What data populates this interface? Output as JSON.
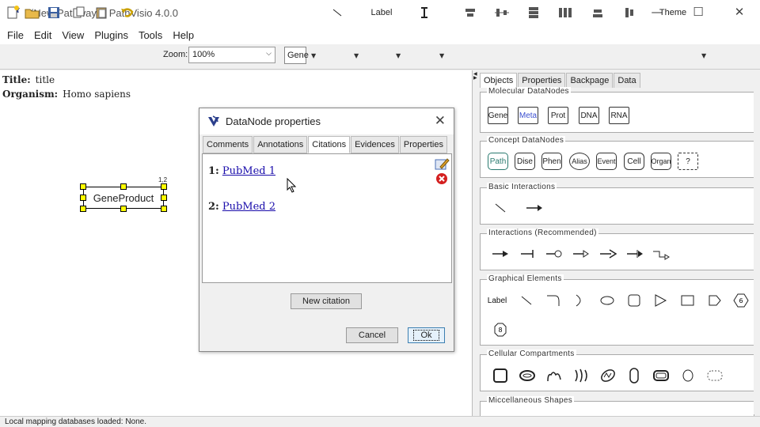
{
  "window": {
    "title": "*(New Pathway) - PathVisio 4.0.0"
  },
  "menu": [
    "File",
    "Edit",
    "View",
    "Plugins",
    "Tools",
    "Help"
  ],
  "toolbar": {
    "zoom_label": "Zoom:",
    "zoom_value": "100%",
    "node_type": "Gene",
    "label_tool": "Label",
    "theme_label": "Theme"
  },
  "canvas": {
    "title_key": "Title:",
    "title_value": "title",
    "organism_key": "Organism:",
    "organism_value": "Homo sapiens",
    "node_label": "GeneProduct",
    "node_badge": "1,2"
  },
  "right_panel": {
    "tabs": [
      "Objects",
      "Properties",
      "Backpage",
      "Data"
    ],
    "groups": {
      "molecular": {
        "title": "Molecular DataNodes",
        "items": [
          "Gene",
          "Meta",
          "Prot",
          "DNA",
          "RNA"
        ]
      },
      "concept": {
        "title": "Concept DataNodes",
        "items": [
          "Path",
          "Dise",
          "Phen",
          "Alias",
          "Event",
          "Cell",
          "Organ",
          "?"
        ]
      },
      "basic": {
        "title": "Basic Interactions"
      },
      "interactions": {
        "title": "Interactions (Recommended)"
      },
      "graphical": {
        "title": "Graphical Elements",
        "label_item": "Label"
      },
      "cellular": {
        "title": "Cellular Compartments"
      },
      "misc": {
        "title": "Miccellaneous Shapes"
      }
    }
  },
  "dialog": {
    "title": "DataNode properties",
    "tabs": [
      "Comments",
      "Annotations",
      "Citations",
      "Evidences",
      "Properties"
    ],
    "citations": [
      {
        "num": "1:",
        "text": "PubMed 1"
      },
      {
        "num": "2:",
        "text": "PubMed 2"
      }
    ],
    "new_citation": "New citation",
    "cancel": "Cancel",
    "ok": "Ok"
  },
  "status": {
    "text": "Local mapping databases loaded: None."
  },
  "colors": {
    "meta_text": "#3b4fd0",
    "concept_text": "#2a7a6f",
    "selection_handle": "#ffff00",
    "link": "#1a0dab"
  }
}
